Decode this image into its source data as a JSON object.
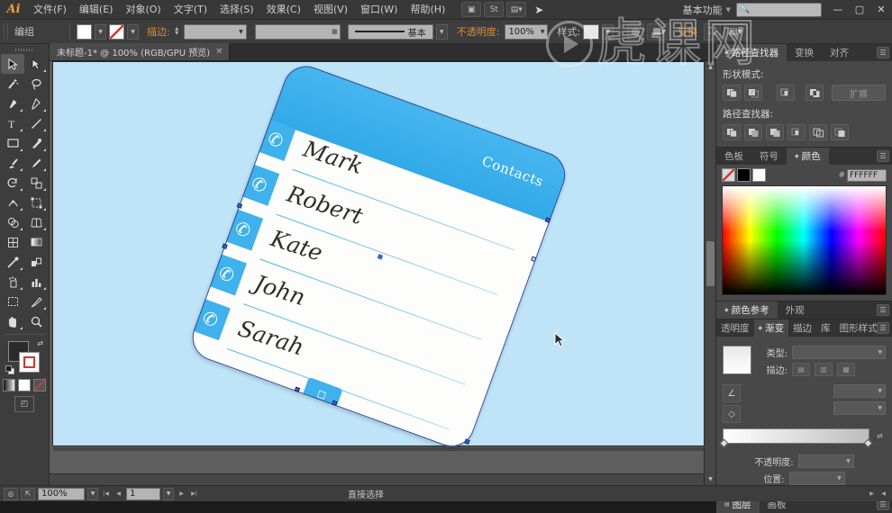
{
  "app": {
    "name": "Adobe Illustrator",
    "logo": "Ai"
  },
  "menubar": {
    "items": [
      {
        "label": "文件(F)",
        "name": "menu-file"
      },
      {
        "label": "编辑(E)",
        "name": "menu-edit"
      },
      {
        "label": "对象(O)",
        "name": "menu-object"
      },
      {
        "label": "文字(T)",
        "name": "menu-type"
      },
      {
        "label": "选择(S)",
        "name": "menu-select"
      },
      {
        "label": "效果(C)",
        "name": "menu-effect"
      },
      {
        "label": "视图(V)",
        "name": "menu-view"
      },
      {
        "label": "窗口(W)",
        "name": "menu-window"
      },
      {
        "label": "帮助(H)",
        "name": "menu-help"
      }
    ],
    "bridge_icon": "bridge-icon",
    "stock_icon": "st-icon",
    "arrange_icon": "arrange-documents-icon",
    "share_icon": "share-on-behance-icon",
    "workspace": "基本功能",
    "search_placeholder": "",
    "search_value": "",
    "minimize": "—",
    "maximize": "▢",
    "close": "✕"
  },
  "controlbar": {
    "selection_label": "编组",
    "fill_label": "",
    "stroke_label": "描边:",
    "stroke_weight": "",
    "dash_value": "",
    "profile_label": "基本",
    "opacity_label": "不透明度:",
    "opacity_value": "100%",
    "style_label": "样式:",
    "isolate_icon": "isolate-group-icon",
    "mask_icon": "opacity-mask-icon",
    "transform_label": "变换",
    "align_icon": "align-icon",
    "doc_setup_icon": "document-setup-icon"
  },
  "tools": {
    "column1": [
      {
        "name": "selection-tool",
        "glyph": "selection"
      },
      {
        "name": "magic-wand-tool",
        "glyph": "wand"
      },
      {
        "name": "pen-tool",
        "glyph": "pen"
      },
      {
        "name": "type-tool",
        "glyph": "T"
      },
      {
        "name": "rectangle-tool",
        "glyph": "rect"
      },
      {
        "name": "paintbrush-tool",
        "glyph": "brush"
      },
      {
        "name": "rotate-tool",
        "glyph": "rotate"
      },
      {
        "name": "width-tool",
        "glyph": "width"
      },
      {
        "name": "shape-builder-tool",
        "glyph": "shapebuilder"
      },
      {
        "name": "mesh-tool",
        "glyph": "mesh"
      },
      {
        "name": "eyedropper-tool",
        "glyph": "eyedropper"
      },
      {
        "name": "symbol-sprayer-tool",
        "glyph": "symbol"
      },
      {
        "name": "artboard-tool",
        "glyph": "artboard"
      },
      {
        "name": "hand-tool",
        "glyph": "hand"
      }
    ],
    "column2": [
      {
        "name": "direct-selection-tool",
        "glyph": "directselect"
      },
      {
        "name": "lasso-tool",
        "glyph": "lasso"
      },
      {
        "name": "curvature-tool",
        "glyph": "curvature"
      },
      {
        "name": "line-segment-tool",
        "glyph": "line"
      },
      {
        "name": "paintbrush-blob-tool",
        "glyph": "blob"
      },
      {
        "name": "pencil-tool",
        "glyph": "pencil"
      },
      {
        "name": "scale-tool",
        "glyph": "scale"
      },
      {
        "name": "free-transform-tool",
        "glyph": "freetransform"
      },
      {
        "name": "perspective-grid-tool",
        "glyph": "perspective"
      },
      {
        "name": "gradient-tool",
        "glyph": "gradient"
      },
      {
        "name": "blend-tool",
        "glyph": "blend"
      },
      {
        "name": "column-graph-tool",
        "glyph": "graph"
      },
      {
        "name": "slice-tool",
        "glyph": "slice"
      },
      {
        "name": "zoom-tool",
        "glyph": "zoom"
      }
    ],
    "help_glyph": "?",
    "fill_color": "#2b2b2b",
    "stroke_color": "#ffffff",
    "color_modes": [
      "gradient-mode",
      "white-mode",
      "none-mode"
    ],
    "screen_mode": "screen-mode-icon"
  },
  "document": {
    "tab_title": "未标题-1* @ 100% (RGB/GPU 预览)",
    "close_glyph": "✕"
  },
  "canvas": {
    "artboard_color": "#bfe3f7",
    "accent_color": "#3fb1ec",
    "card_color": "#fdfdfb",
    "header_title": "Contacts",
    "contacts": [
      {
        "name": "Mark",
        "icon": "phone-icon"
      },
      {
        "name": "Robert",
        "icon": "phone-icon"
      },
      {
        "name": "Kate",
        "icon": "phone-icon"
      },
      {
        "name": "John",
        "icon": "phone-icon"
      },
      {
        "name": "Sarah",
        "icon": "phone-icon"
      }
    ],
    "home_button_icon": "home-button-icon",
    "cursor": "arrow-cursor"
  },
  "watermark": {
    "text": [
      "虎",
      "课",
      "网"
    ],
    "play": "play-icon"
  },
  "statusbar": {
    "zoom_value": "100%",
    "artboard_number": "1",
    "status_text": "直接选择"
  },
  "panels": {
    "pathfinder": {
      "tabs": [
        {
          "label": "路径查找器",
          "active": true
        },
        {
          "label": "变换",
          "active": false
        },
        {
          "label": "对齐",
          "active": false
        }
      ],
      "shape_modes_label": "形状模式:",
      "shape_modes": [
        "unite-icon",
        "minus-front-icon",
        "intersect-icon",
        "exclude-icon"
      ],
      "expand_label": "扩展",
      "pathfinders_label": "路径查找器:",
      "pathfinders": [
        "divide-icon",
        "trim-icon",
        "merge-icon",
        "crop-icon",
        "outline-icon",
        "minus-back-icon"
      ],
      "menu_icon": "panel-menu-icon"
    },
    "color": {
      "tabs": [
        {
          "label": "色板",
          "active": false
        },
        {
          "label": "符号",
          "active": false
        },
        {
          "label": "颜色",
          "active": true
        }
      ],
      "none_swatch": "none-swatch",
      "black_swatch": "black-swatch",
      "white_swatch": "white-swatch",
      "hex_symbol": "#",
      "hex_value": "FFFFFF",
      "menu_icon": "panel-menu-icon"
    },
    "appearance": {
      "tabs": [
        {
          "label": "颜色参考",
          "active": true
        },
        {
          "label": "外观",
          "active": false
        }
      ],
      "menu_icon": "panel-menu-icon"
    },
    "gradient": {
      "tabs": [
        {
          "label": "透明度",
          "active": false
        },
        {
          "label": "渐变",
          "active": true
        },
        {
          "label": "描边",
          "active": false
        },
        {
          "label": "库",
          "active": false
        },
        {
          "label": "图形样式",
          "active": false
        }
      ],
      "type_label": "类型:",
      "type_value": "",
      "stroke_label": "描边:",
      "angle_label": "",
      "angle_value": "",
      "ratio_label": "",
      "ratio_value": "",
      "opacity_label": "不透明度:",
      "opacity_value": "",
      "position_label": "位置:",
      "position_value": "",
      "reverse_icon": "reverse-gradient-icon",
      "menu_icon": "panel-menu-icon"
    },
    "layers": {
      "tabs": [
        {
          "label": "图层",
          "active": true
        },
        {
          "label": "画板",
          "active": false
        }
      ],
      "menu_icon": "panel-menu-icon"
    }
  }
}
